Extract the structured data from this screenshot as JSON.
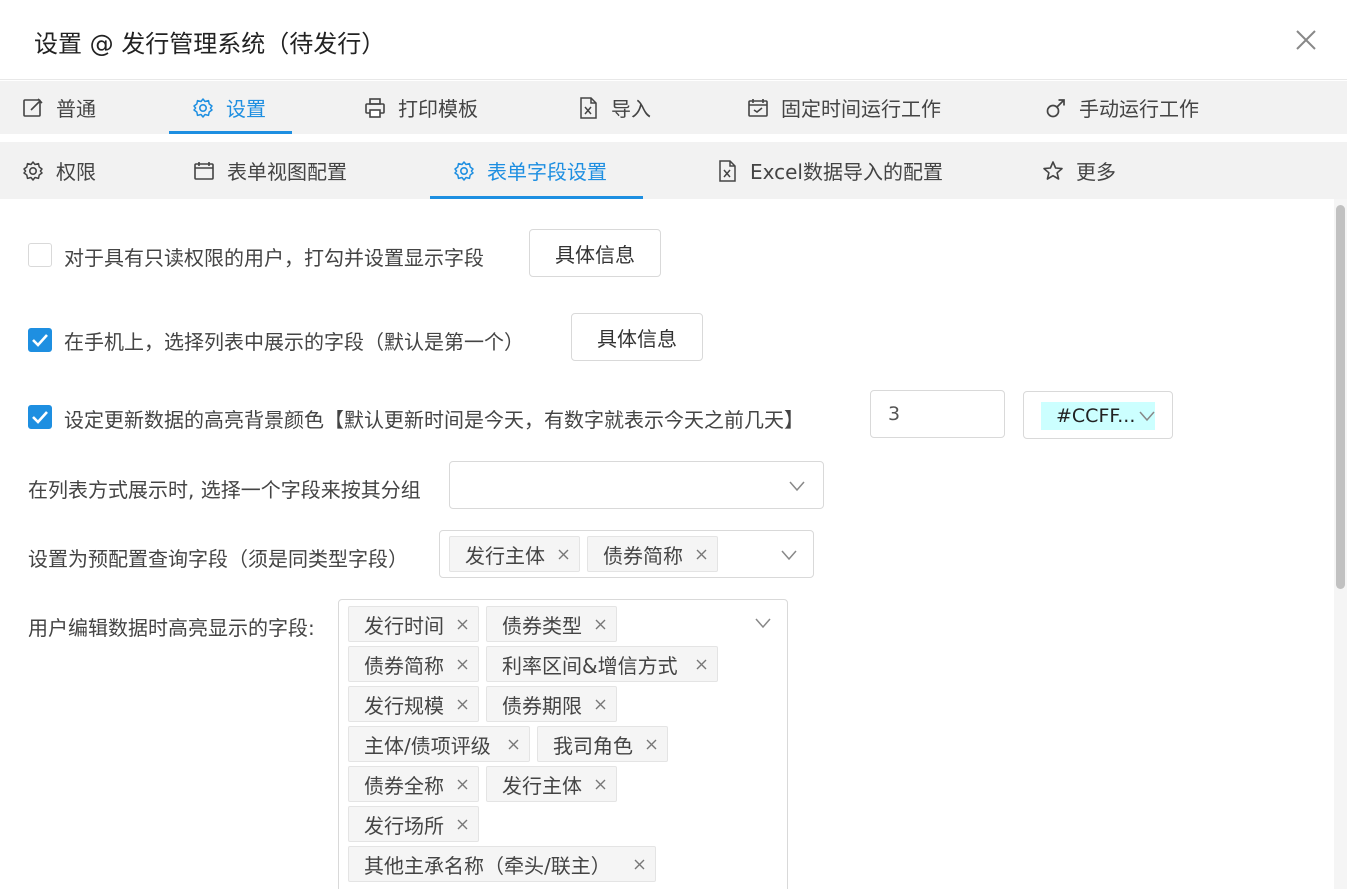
{
  "window": {
    "title": "设置 @ 发行管理系统（待发行）"
  },
  "tabs_row1": [
    {
      "label": "普通",
      "icon": "edit-icon"
    },
    {
      "label": "设置",
      "icon": "gear-icon"
    },
    {
      "label": "打印模板",
      "icon": "printer-icon"
    },
    {
      "label": "导入",
      "icon": "excel-file-icon"
    },
    {
      "label": "固定时间运行工作",
      "icon": "calendar-clock-icon"
    },
    {
      "label": "手动运行工作",
      "icon": "male-icon"
    }
  ],
  "tabs_row2": [
    {
      "label": "权限",
      "icon": "gear-icon"
    },
    {
      "label": "表单视图配置",
      "icon": "calendar-icon"
    },
    {
      "label": "表单字段设置",
      "icon": "gear-icon"
    },
    {
      "label": "Excel数据导入的配置",
      "icon": "excel-file-icon"
    },
    {
      "label": "更多",
      "icon": "star-icon"
    }
  ],
  "active_tabs": {
    "row1": "设置",
    "row2": "表单字段设置"
  },
  "settings": {
    "readonly_fields": {
      "label": "对于具有只读权限的用户，打勾并设置显示字段",
      "checked": false,
      "button": "具体信息"
    },
    "mobile_fields": {
      "label": "在手机上，选择列表中展示的字段（默认是第一个）",
      "checked": true,
      "button": "具体信息"
    },
    "highlight": {
      "label": "设定更新数据的高亮背景颜色【默认更新时间是今天，有数字就表示今天之前几天】",
      "checked": true,
      "days": "3",
      "color_label": "#CCFF...",
      "color": "#ccffff"
    },
    "group_by": {
      "label": "在列表方式展示时, 选择一个字段来按其分组",
      "value": ""
    },
    "preset_query": {
      "label": "设置为预配置查询字段（须是同类型字段）",
      "tags": [
        "发行主体",
        "债券简称"
      ]
    },
    "highlight_fields": {
      "label": "用户编辑数据时高亮显示的字段:",
      "tags": [
        "发行时间",
        "债券类型",
        "债券简称",
        "利率区间&增信方式",
        "发行规模",
        "债券期限",
        "主体/债项评级",
        "我司角色",
        "债券全称",
        "发行主体",
        "发行场所",
        "其他主承名称（牵头/联主）"
      ]
    }
  },
  "colors": {
    "accent": "#1e8fe1",
    "tab_bar_bg": "#f2f2f2",
    "checkbox_checked": "#1e8fe1"
  }
}
